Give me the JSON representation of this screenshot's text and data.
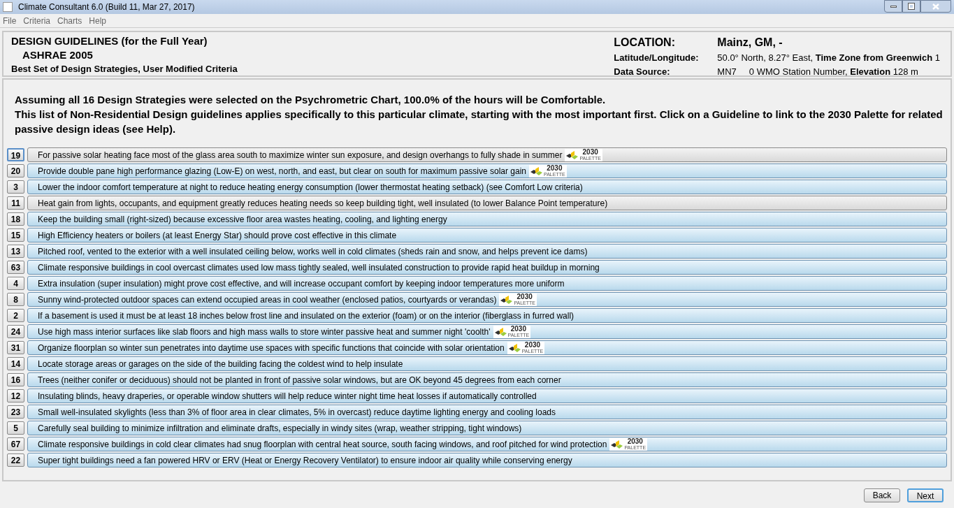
{
  "window": {
    "title": "Climate Consultant 6.0 (Build 11, Mar 27, 2017)"
  },
  "menu": [
    "File",
    "Criteria",
    "Charts",
    "Help"
  ],
  "header": {
    "title": "DESIGN GUIDELINES (for the Full Year)",
    "standard": "ASHRAE 2005",
    "subtitle": "Best Set of Design Strategies, User Modified Criteria",
    "location_label": "LOCATION:",
    "location": "Mainz, GM, -",
    "latlon_label": "Latitude/Longitude:",
    "latlon": "50.0° North, 8.27° East, **Time Zone from Greenwich** 1",
    "source_label": "Data Source:",
    "source": "MN7     0 WMO Station Number, **Elevation** 128 m"
  },
  "intro": [
    "Assuming all 16 Design Strategies were selected on the Psychrometric Chart, 100.0% of the hours will be Comfortable.",
    "This list of Non-Residential Design guidelines applies specifically to this particular climate, starting with the most important first.  Click on a Guideline to link to the 2030 Palette for related passive design ideas (see Help)."
  ],
  "guidelines": [
    {
      "number": "19",
      "focused": true,
      "highlighted": true,
      "text": "For passive solar heating face most of the glass area south to maximize winter sun exposure, and design overhangs to fully shade in summer",
      "badge": {
        "number": "2030",
        "word": "PALETTE"
      }
    },
    {
      "number": "20",
      "focused": false,
      "highlighted": false,
      "text": "Provide double pane high performance glazing (Low-E) on west, north, and east, but clear on south for maximum passive solar gain",
      "badge": {
        "number": "2030",
        "word": "PALETTE"
      }
    },
    {
      "number": "3",
      "focused": false,
      "highlighted": false,
      "text": "Lower the indoor comfort temperature at night to reduce heating energy consumption (lower thermostat heating setback) (see Comfort Low criteria)"
    },
    {
      "number": "11",
      "focused": false,
      "highlighted": true,
      "text": "Heat gain from lights, occupants, and equipment greatly reduces heating needs so keep building tight, well insulated (to lower Balance Point temperature)"
    },
    {
      "number": "18",
      "focused": false,
      "highlighted": false,
      "text": "Keep the building small (right-sized) because excessive floor area wastes heating, cooling, and lighting energy"
    },
    {
      "number": "15",
      "focused": false,
      "highlighted": false,
      "text": "High Efficiency heaters or boilers (at least Energy Star) should prove cost effective in this climate"
    },
    {
      "number": "13",
      "focused": false,
      "highlighted": false,
      "text": "Pitched roof, vented to the exterior with a well insulated ceiling below, works well in cold climates (sheds rain and snow, and helps prevent ice dams)"
    },
    {
      "number": "63",
      "focused": false,
      "highlighted": false,
      "text": "Climate responsive buildings in cool overcast climates used low mass tightly sealed, well insulated construction to provide rapid heat buildup in morning"
    },
    {
      "number": "4",
      "focused": false,
      "highlighted": false,
      "text": "Extra insulation (super insulation) might prove cost effective, and will increase occupant comfort by keeping indoor temperatures more uniform"
    },
    {
      "number": "8",
      "focused": false,
      "highlighted": false,
      "text": "Sunny wind-protected outdoor spaces can extend occupied areas in cool weather (enclosed patios, courtyards or verandas)",
      "badge": {
        "number": "2030",
        "word": "PALETTE"
      }
    },
    {
      "number": "2",
      "focused": false,
      "highlighted": false,
      "text": "If a basement is used it must be at least 18 inches below frost line and insulated on the exterior (foam) or on the interior (fiberglass in furred wall)"
    },
    {
      "number": "24",
      "focused": false,
      "highlighted": false,
      "text": "Use high mass interior surfaces like slab floors and high mass walls to store winter passive heat and summer night 'coolth'",
      "badge": {
        "number": "2030",
        "word": "PALETTE"
      }
    },
    {
      "number": "31",
      "focused": false,
      "highlighted": false,
      "text": "Organize floorplan so winter sun penetrates into daytime use spaces with specific functions that coincide with solar orientation",
      "badge": {
        "number": "2030",
        "word": "PALETTE"
      }
    },
    {
      "number": "14",
      "focused": false,
      "highlighted": false,
      "text": "Locate storage areas or garages on the side of the building facing the coldest wind to help insulate"
    },
    {
      "number": "16",
      "focused": false,
      "highlighted": false,
      "text": "Trees (neither conifer or deciduous) should not be planted in front of passive solar windows, but are OK beyond 45 degrees from each corner"
    },
    {
      "number": "12",
      "focused": false,
      "highlighted": false,
      "text": "Insulating blinds, heavy draperies, or operable window shutters will help reduce winter night time heat losses if automatically controlled"
    },
    {
      "number": "23",
      "focused": false,
      "highlighted": false,
      "text": "Small well-insulated skylights (less than 3% of floor area in clear climates, 5% in overcast) reduce daytime lighting energy and cooling loads"
    },
    {
      "number": "5",
      "focused": false,
      "highlighted": false,
      "text": "Carefully seal building to minimize infiltration and eliminate drafts, especially in windy sites (wrap, weather stripping, tight windows)"
    },
    {
      "number": "67",
      "focused": false,
      "highlighted": false,
      "text": "Climate responsive buildings in cold clear climates had snug floorplan with central heat source, south facing windows, and roof pitched for wind protection",
      "badge": {
        "number": "2030",
        "word": "PALETTE"
      }
    },
    {
      "number": "22",
      "focused": false,
      "highlighted": false,
      "text": "Super tight buildings need a fan powered HRV or ERV (Heat or Energy Recovery Ventilator) to ensure indoor air quality while conserving energy"
    }
  ],
  "buttons": [
    {
      "label": "Back",
      "focused": false
    },
    {
      "label": "Next",
      "focused": true
    }
  ]
}
